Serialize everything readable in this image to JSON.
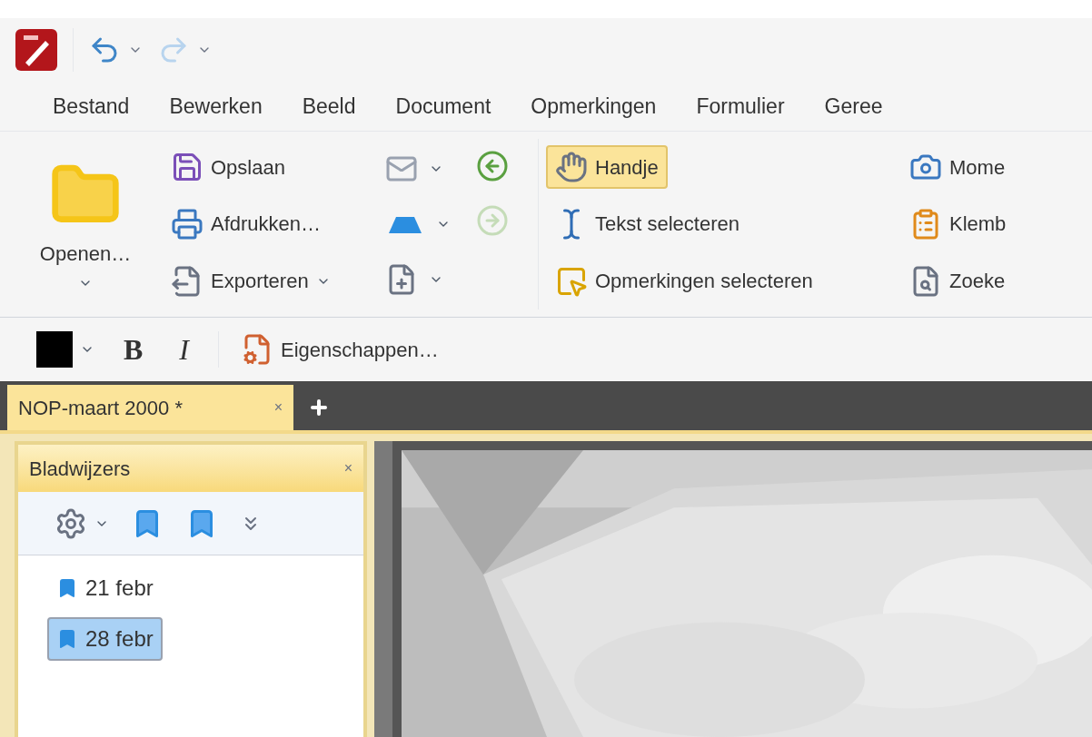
{
  "quick_access": [
    {
      "kind": "undo",
      "disabled": false
    },
    {
      "kind": "redo",
      "disabled": true
    }
  ],
  "menu": [
    "Bestand",
    "Bewerken",
    "Beeld",
    "Document",
    "Opmerkingen",
    "Formulier",
    "Geree"
  ],
  "ribbon": {
    "open": "Openen…",
    "file_actions": [
      {
        "kind": "save",
        "label": "Opslaan"
      },
      {
        "kind": "print",
        "label": "Afdrukken…"
      },
      {
        "kind": "export",
        "label": "Exporteren"
      }
    ],
    "tools": [
      {
        "kind": "hand",
        "label": "Handje",
        "selected": true
      },
      {
        "kind": "text",
        "label": "Tekst selecteren",
        "selected": false
      },
      {
        "kind": "comments",
        "label": "Opmerkingen selecteren",
        "selected": false
      }
    ],
    "more_tools": [
      {
        "kind": "camera",
        "label": "Mome"
      },
      {
        "kind": "clipboard",
        "label": "Klemb"
      },
      {
        "kind": "search",
        "label": "Zoeke"
      }
    ]
  },
  "format_bar": {
    "bold": "B",
    "italic": "I",
    "properties": "Eigenschappen…"
  },
  "document_tabs": [
    {
      "label": "NOP-maart 2000 *",
      "close": "×",
      "selected": true
    }
  ],
  "bookmarks": {
    "title": "Bladwijzers",
    "close": "×",
    "items": [
      {
        "label": "21 febr",
        "selected": false
      },
      {
        "label": "28 febr",
        "selected": true
      }
    ]
  }
}
